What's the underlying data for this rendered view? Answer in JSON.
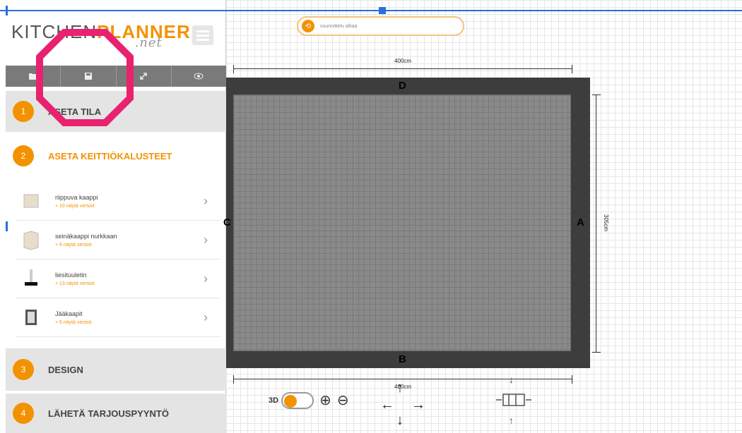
{
  "logo": {
    "part1": "KITCHEN",
    "part2": "PLANNER",
    "part3": ".net"
  },
  "toolbar": {
    "open_icon": "folder-icon",
    "save_icon": "save-icon",
    "expand_icon": "expand-icon",
    "view_icon": "eye-icon"
  },
  "steps": [
    {
      "num": "1",
      "label": "ASETA TILA"
    },
    {
      "num": "2",
      "label": "ASETA KEITTIÖKALUSTEET"
    },
    {
      "num": "3",
      "label": "DESIGN"
    },
    {
      "num": "4",
      "label": "LÄHETÄ TARJOUSPYYNTÖ"
    }
  ],
  "items": [
    {
      "title": "riippuva kaappi",
      "sub": "+ 10 näytä versiot"
    },
    {
      "title": "seinäkaappi nurkkaan",
      "sub": "+ 6 näytä versiot"
    },
    {
      "title": "liesituuletin",
      "sub": "+ 13 näytä versiot"
    },
    {
      "title": "Jääkaapit",
      "sub": "+ 6 näytä versiot"
    }
  ],
  "canvas": {
    "search_placeholder": "suunnittelu alkaa",
    "width_label": "400cm",
    "height_label": "305cm",
    "bottom_label": "400cm",
    "walls": {
      "top": "D",
      "bottom": "B",
      "left": "C",
      "right": "A"
    },
    "toggle_label": "3D"
  },
  "colors": {
    "accent": "#f39200",
    "selection": "#2a6ede",
    "annotation": "#e8226f"
  }
}
